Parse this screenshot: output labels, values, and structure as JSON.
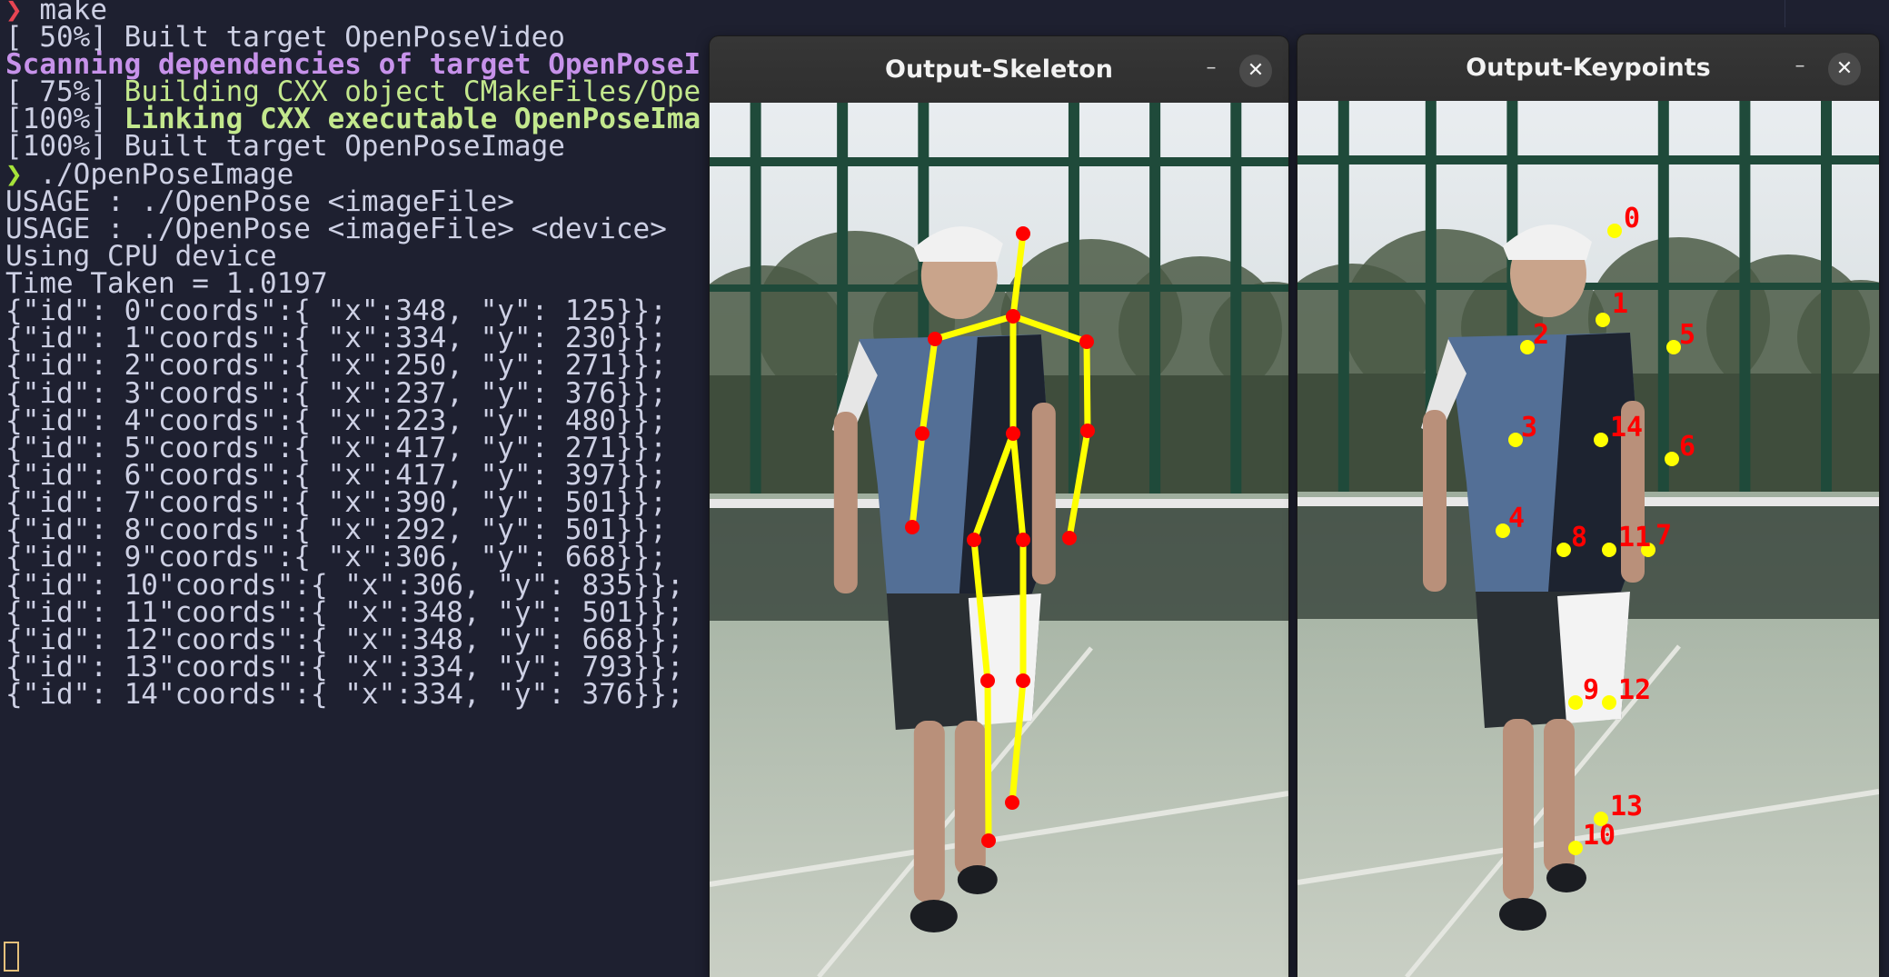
{
  "terminal": {
    "prompt_symbol": "❯",
    "cmd1": "make",
    "build1": "[ 50%] Built target OpenPoseVideo",
    "scan": "Scanning dependencies of target OpenPoseI",
    "build2_prefix": "[ 75%] ",
    "build2_text": "Building CXX object CMakeFiles/Ope",
    "link_prefix": "[100%] ",
    "link_text": "Linking CXX executable OpenPoseIma",
    "build3": "[100%] Built target OpenPoseImage",
    "cmd2": "./OpenPoseImage",
    "usage1": "USAGE : ./OpenPose <imageFile>",
    "usage2": "USAGE : ./OpenPose <imageFile> <device>",
    "device": "Using CPU device",
    "time": "Time Taken = 1.0197",
    "coords": [
      "{\"id\": 0\"coords\":{ \"x\":348, \"y\": 125}};",
      "{\"id\": 1\"coords\":{ \"x\":334, \"y\": 230}};",
      "{\"id\": 2\"coords\":{ \"x\":250, \"y\": 271}};",
      "{\"id\": 3\"coords\":{ \"x\":237, \"y\": 376}};",
      "{\"id\": 4\"coords\":{ \"x\":223, \"y\": 480}};",
      "{\"id\": 5\"coords\":{ \"x\":417, \"y\": 271}};",
      "{\"id\": 6\"coords\":{ \"x\":417, \"y\": 397}};",
      "{\"id\": 7\"coords\":{ \"x\":390, \"y\": 501}};",
      "{\"id\": 8\"coords\":{ \"x\":292, \"y\": 501}};",
      "{\"id\": 9\"coords\":{ \"x\":306, \"y\": 668}};",
      "{\"id\": 10\"coords\":{ \"x\":306, \"y\": 835}};",
      "{\"id\": 11\"coords\":{ \"x\":348, \"y\": 501}};",
      "{\"id\": 12\"coords\":{ \"x\":348, \"y\": 668}};",
      "{\"id\": 13\"coords\":{ \"x\":334, \"y\": 793}};",
      "{\"id\": 14\"coords\":{ \"x\":334, \"y\": 376}};"
    ]
  },
  "windows": {
    "skeleton": {
      "title": "Output-Skeleton",
      "minimize": "–",
      "close": "✕"
    },
    "keypoints": {
      "title": "Output-Keypoints",
      "minimize": "–",
      "close": "✕"
    }
  },
  "keypoint_labels": [
    "0",
    "1",
    "2",
    "3",
    "4",
    "5",
    "6",
    "7",
    "8",
    "9",
    "10",
    "11",
    "12",
    "13",
    "14"
  ],
  "colors": {
    "terminal_bg": "#1e2030",
    "limb": "#ffff00",
    "joint": "#ff0000",
    "keypoint_dot": "#ffff00",
    "keypoint_label": "#ff0000"
  }
}
